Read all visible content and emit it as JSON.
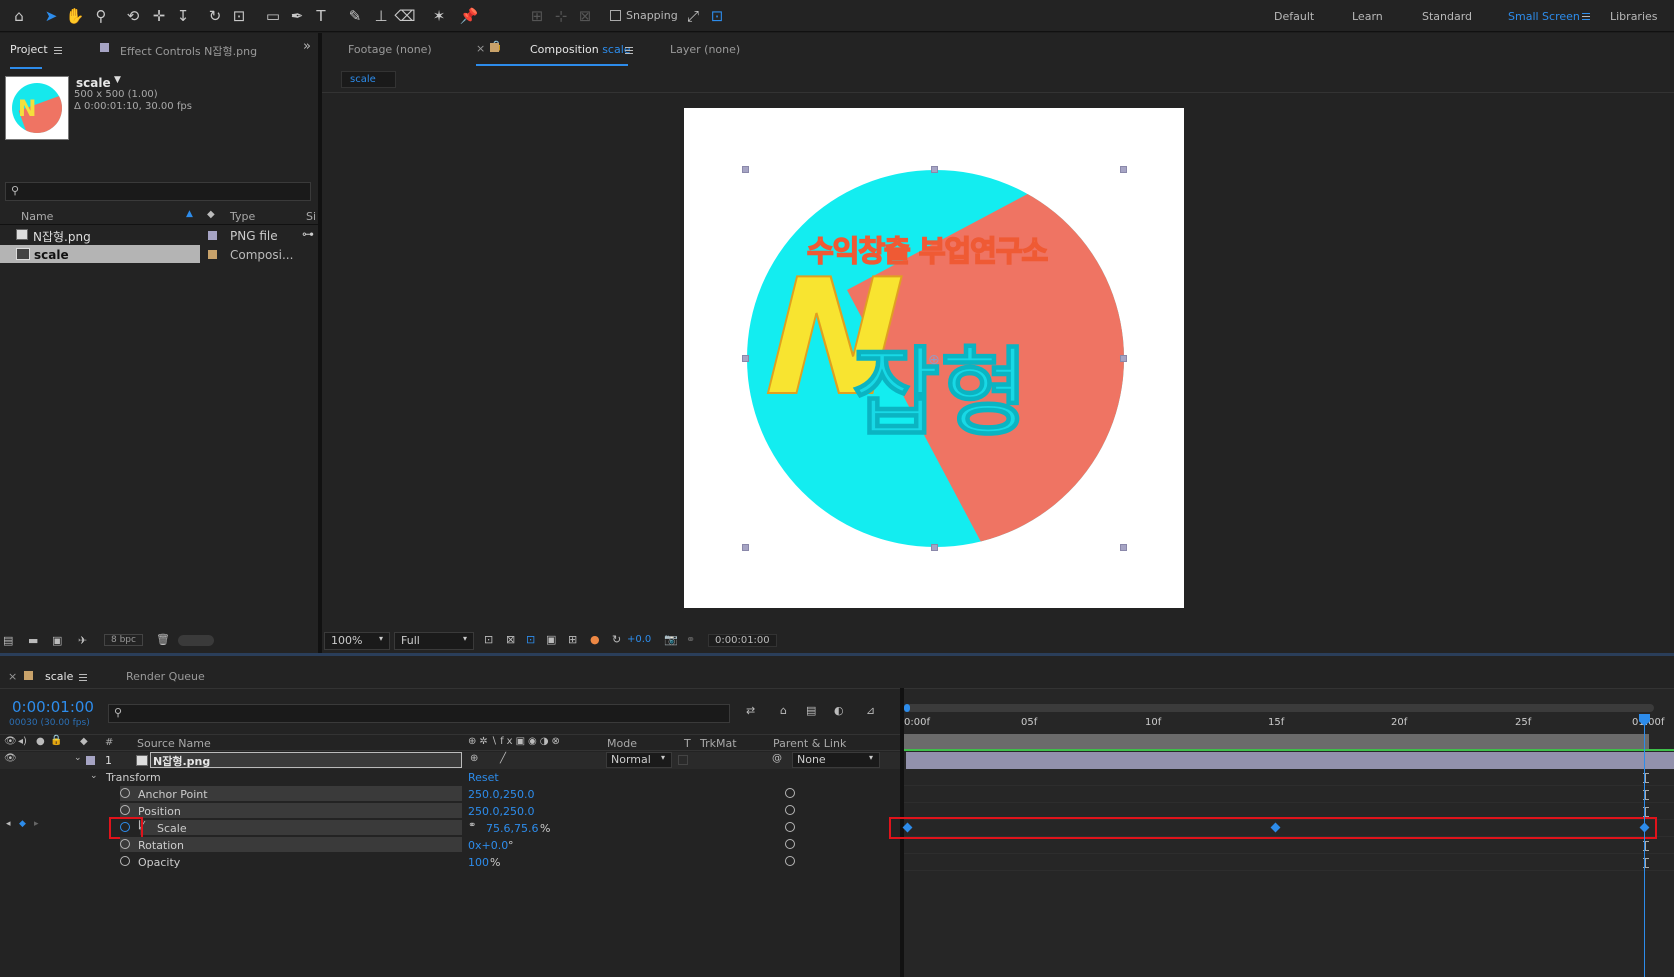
{
  "toolbar": {
    "snapping_label": "Snapping",
    "workspaces": [
      "Default",
      "Learn",
      "Standard",
      "Small Screen",
      "Libraries"
    ],
    "active_workspace": "Small Screen"
  },
  "project": {
    "tab_label": "Project",
    "effect_controls_label": "Effect Controls N잡형.png",
    "item_name": "scale",
    "item_size": "500 x 500 (1.00)",
    "item_duration": "Δ 0:00:01:10, 30.00 fps",
    "columns": {
      "name": "Name",
      "type": "Type",
      "size": "Si"
    },
    "rows": [
      {
        "name": "N잡형.png",
        "type": "PNG file"
      },
      {
        "name": "scale",
        "type": "Composi..."
      }
    ],
    "bpc_label": "8 bpc"
  },
  "composition": {
    "footage_tab": "Footage  (none)",
    "comp_tab_prefix": "Composition",
    "comp_tab_name": "scale",
    "layer_tab": "Layer  (none)",
    "comp_chip": "scale",
    "banner_text": "수익창출 부업연구소",
    "logo_letter": "N",
    "logo_text": "잡형",
    "zoom": "100%",
    "quality": "Full",
    "exposure": "+0.0",
    "timecode": "0:00:01:00"
  },
  "timeline": {
    "comp_tab": "scale",
    "render_queue_tab": "Render Queue",
    "current_time": "0:00:01:00",
    "frame_info": "00030 (30.00 fps)",
    "headers": {
      "hash": "#",
      "source_name": "Source Name",
      "mode": "Mode",
      "t": "T",
      "trkmat": "TrkMat",
      "parent": "Parent & Link"
    },
    "layer": {
      "index": "1",
      "name": "N잡형.png",
      "mode": "Normal",
      "parent": "None"
    },
    "transform_label": "Transform",
    "reset_label": "Reset",
    "properties": [
      {
        "name": "Anchor Point",
        "value": "250.0,250.0"
      },
      {
        "name": "Position",
        "value": "250.0,250.0"
      },
      {
        "name": "Scale",
        "value": "75.6,75.6",
        "unit": "%"
      },
      {
        "name": "Rotation",
        "value": "0x+0.0",
        "unit": "°"
      },
      {
        "name": "Opacity",
        "value": "100",
        "unit": "%"
      }
    ],
    "ruler_labels": [
      "0:00f",
      "05f",
      "10f",
      "15f",
      "20f",
      "25f",
      "01:00f"
    ],
    "colors": {
      "accent": "#2d8ceb",
      "highlight_box": "#e0131b",
      "layer_bar": "#a6a4c4"
    }
  }
}
